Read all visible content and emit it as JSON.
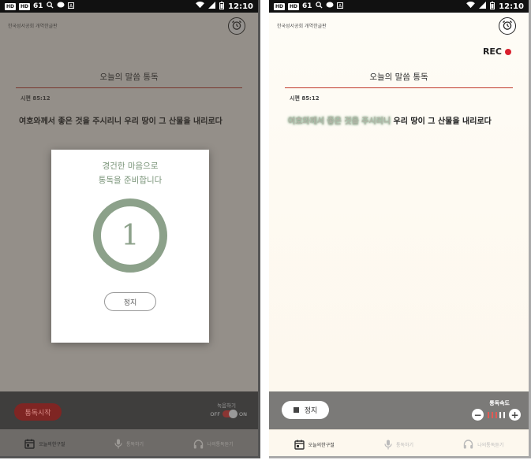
{
  "status_bar": {
    "chip_1": "HD",
    "chip_2": "HD",
    "number": "61",
    "time": "12:10"
  },
  "app": {
    "org_name": "한국성서공회 개역한글판",
    "title": "오늘의 말씀 통독",
    "reference": "시편 85:12",
    "verse_part_1": "여호와께서 좋은 것을 주시리니",
    "verse_part_2": " 우리 땅이 그 산물을 내리로다",
    "rec_label": "REC"
  },
  "modal": {
    "line_1": "경건한 마음으로",
    "line_2": "통독을 준비합니다",
    "countdown": "1",
    "stop_label": "정지"
  },
  "left_controls": {
    "start_label": "통독시작",
    "record_label": "녹음하기",
    "off_label": "OFF",
    "on_label": "ON"
  },
  "right_controls": {
    "stop_label": "정지",
    "speed_label": "통독속도",
    "minus_symbol": "−",
    "plus_symbol": "+",
    "speed_level": 3,
    "speed_max": 5
  },
  "nav": {
    "item_1": "오늘의한구절",
    "item_2": "통독하기",
    "item_3": "나의통독듣기"
  },
  "colors": {
    "accent_red": "#c0392b",
    "ring_green": "#8ca18a",
    "speed_active": "#e25a55",
    "speed_inactive": "#ffffff"
  }
}
